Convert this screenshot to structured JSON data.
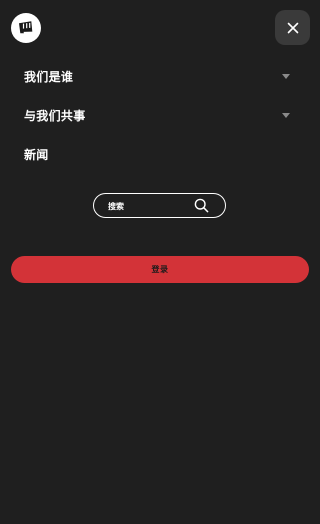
{
  "header": {
    "logo_icon": "fist-logo-icon",
    "close_icon": "close-icon"
  },
  "nav": {
    "items": [
      {
        "label": "我们是谁",
        "has_dropdown": true,
        "icon": "chevron-down-icon"
      },
      {
        "label": "与我们共事",
        "has_dropdown": true,
        "icon": "chevron-down-icon"
      },
      {
        "label": "新闻",
        "has_dropdown": false
      }
    ]
  },
  "search": {
    "placeholder": "搜索",
    "icon": "search-icon"
  },
  "login": {
    "label": "登录"
  },
  "colors": {
    "background": "#1f1f1f",
    "close_button_bg": "#3a3a3a",
    "login_button_bg": "#d33338",
    "text": "#ffffff",
    "caret": "#8a8a8a"
  }
}
